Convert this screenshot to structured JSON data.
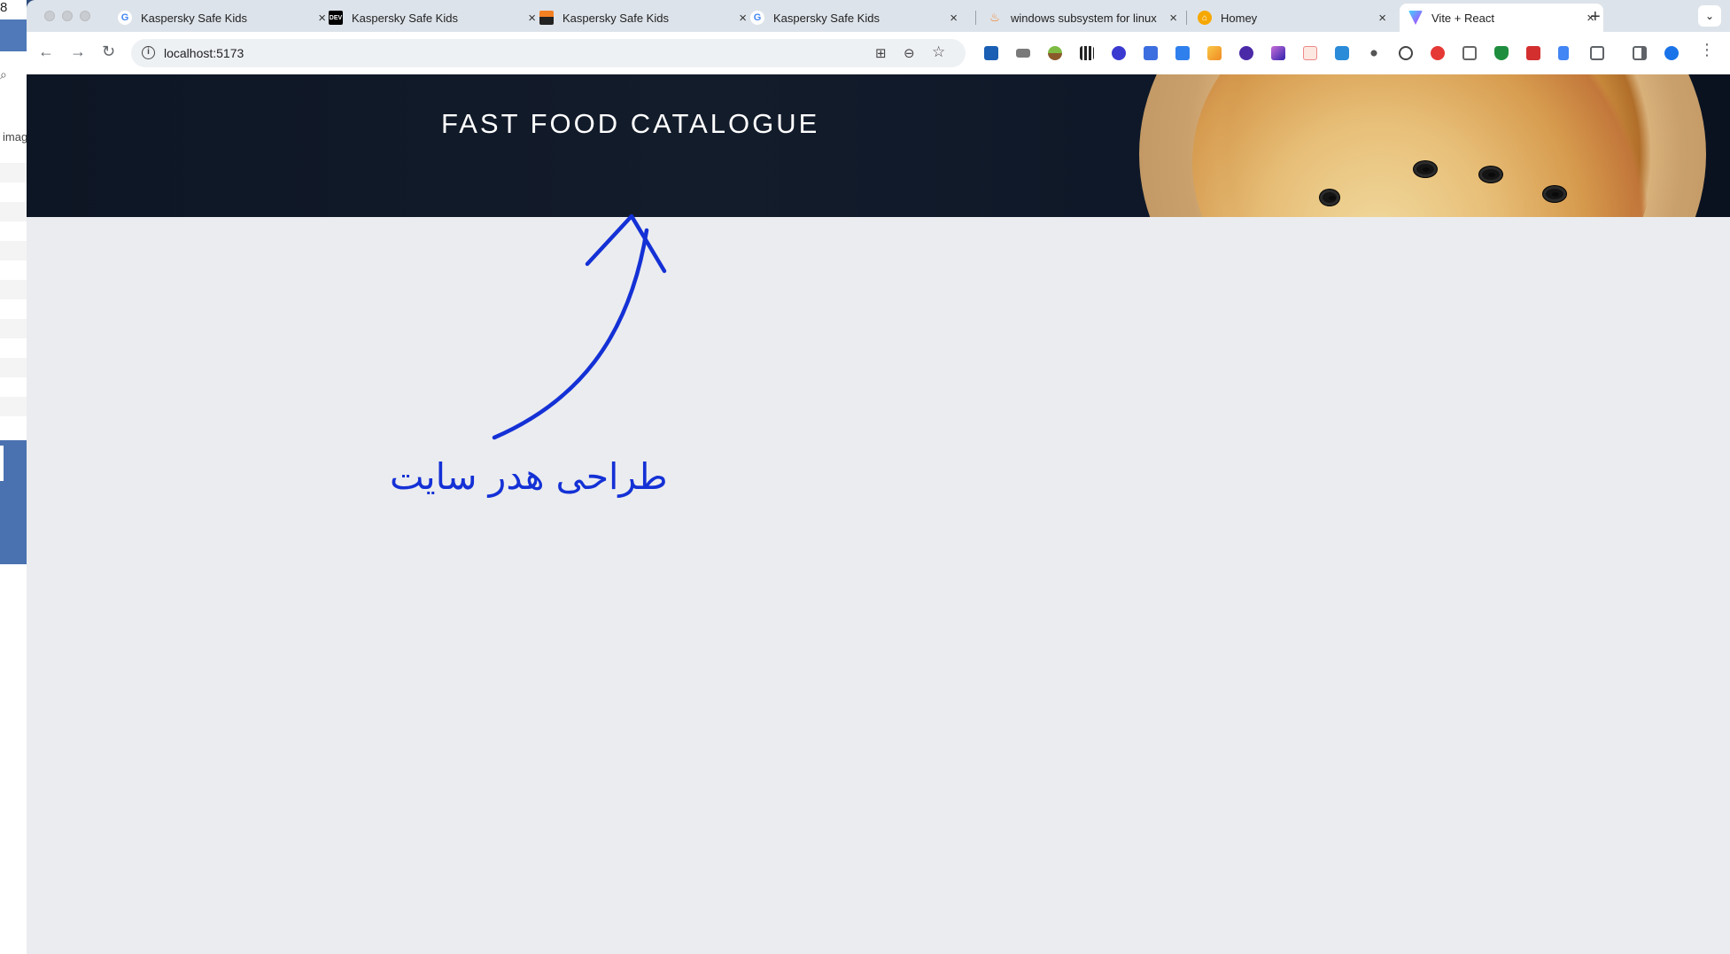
{
  "left_strip": {
    "number": "8",
    "search_glyph": "⌕",
    "partial_text": "imag"
  },
  "tabs": [
    {
      "title": "Kaspersky Safe Kids",
      "favicon": "google-icon",
      "close": "×"
    },
    {
      "title": "Kaspersky Safe Kids",
      "favicon": "dev-icon",
      "favicon_text": "DEV",
      "close": "×"
    },
    {
      "title": "Kaspersky Safe Kids",
      "favicon": "stackoverflow-icon",
      "close": "×"
    },
    {
      "title": "Kaspersky Safe Kids",
      "favicon": "google-icon",
      "close": "×"
    },
    {
      "title": "windows subsystem for linux",
      "favicon": "stackoverflow-icon",
      "close": "×"
    },
    {
      "title": "Homey",
      "favicon": "homey-icon",
      "close": "×"
    },
    {
      "title": "Vite + React",
      "favicon": "vite-icon",
      "close": "×",
      "active": true
    }
  ],
  "toolbar": {
    "back": "←",
    "forward": "→",
    "reload": "↻",
    "url": "localhost:5173",
    "info_glyph": "i"
  },
  "colors": {
    "hero_bg": "#0d1624",
    "annotation": "#1431d6",
    "viewport_bg": "#ebecef"
  },
  "page": {
    "hero_title": "FAST FOOD CATALOGUE",
    "annotation_text": "طراحی هدر سایت"
  }
}
